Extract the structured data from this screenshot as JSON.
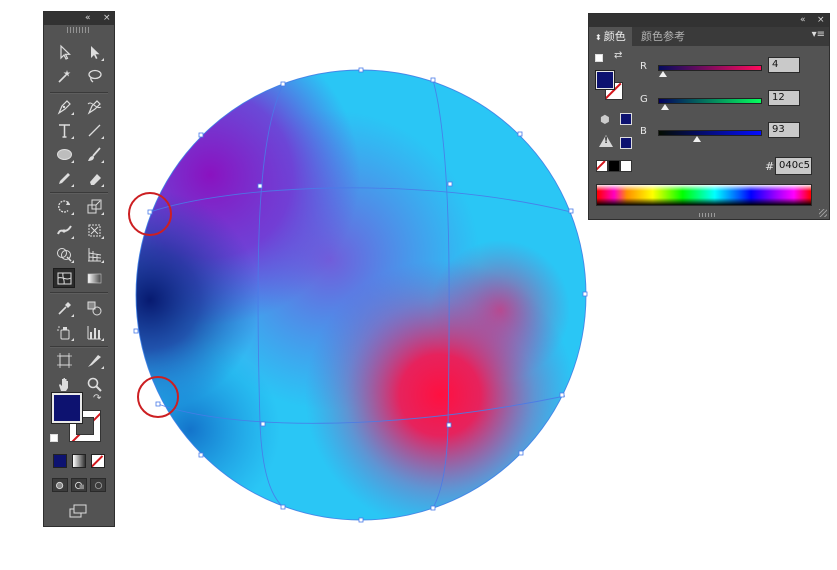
{
  "tools_panel": {
    "collapse_icon": "«",
    "close_icon": "×",
    "fill_color": "#0d1270",
    "stroke": "none"
  },
  "color_panel": {
    "collapse_icon": "«",
    "tabs": [
      {
        "label": "颜色",
        "active": true
      },
      {
        "label": "颜色参考",
        "active": false
      }
    ],
    "tab_arrow": "⬍",
    "menu_icon": "▾≡",
    "sliders": [
      {
        "label": "R",
        "value": "4",
        "fraction": 0.016
      },
      {
        "label": "G",
        "value": "12",
        "fraction": 0.047
      },
      {
        "label": "B",
        "value": "93",
        "fraction": 0.365
      }
    ],
    "hex_label": "#",
    "hex_value": "040c5",
    "current_fill": "#0d1270",
    "alert_icon": "!"
  },
  "artwork": {
    "shape": "mesh-gradient-sphere",
    "colors": {
      "base": "#29c6f5",
      "purple": "#8a1cc4",
      "red": "#f0154a",
      "navy": "#0a1f6e"
    },
    "highlight_circles": 2
  }
}
